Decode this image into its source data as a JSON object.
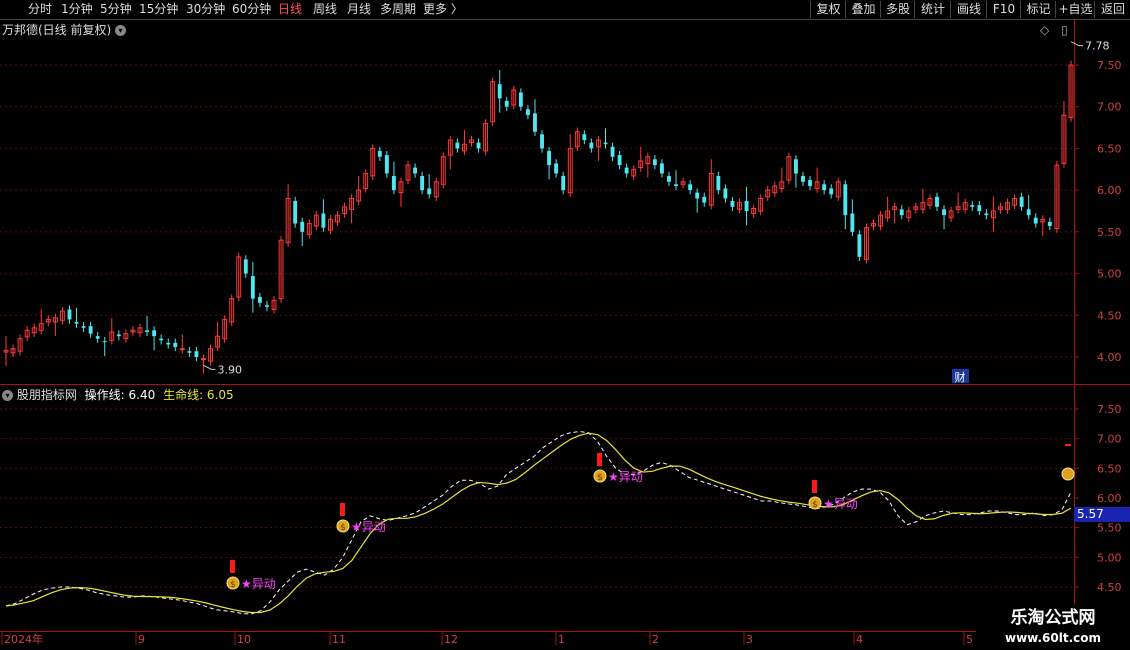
{
  "toolbar": {
    "left": [
      "分时",
      "1分钟",
      "5分钟",
      "15分钟",
      "30分钟",
      "60分钟",
      "日线",
      "周线",
      "月线",
      "多周期",
      "更多 〉"
    ],
    "active_index": 6,
    "right": [
      "复权",
      "叠加",
      "多股",
      "统计",
      "画线",
      "F10",
      "标记",
      "+自选",
      "返回"
    ]
  },
  "main_header": {
    "title": "万邦德(日线 前复权)"
  },
  "indicator_header": {
    "name": "股朋指标网",
    "op_label": "操作线: 6.40",
    "life_label": "生命线: 6.05"
  },
  "main_axis": [
    "7.50",
    "7.00",
    "6.50",
    "6.00",
    "5.50",
    "5.00",
    "4.50",
    "4.00"
  ],
  "sub_axis": [
    "7.50",
    "7.00",
    "6.50",
    "6.00",
    "5.50",
    "5.00",
    "4.50"
  ],
  "annotations": {
    "high": "7.78",
    "low": "3.90",
    "cai": "财"
  },
  "current_value": "5.57",
  "signal_label": "★异动",
  "x_labels": [
    "2024年",
    "9",
    "10",
    "11",
    "12",
    "1",
    "2",
    "3",
    "4",
    "5"
  ],
  "watermark": {
    "line1": "乐淘公式网",
    "line2": "www.60lt.com"
  },
  "colors": {
    "up": "#ff3a3a",
    "down": "#4ee6f0",
    "op_line": "#ffffff",
    "life_line": "#e6e63a",
    "signal": "#ff40ff"
  },
  "chart_data": {
    "type": "candlestick",
    "closes": [
      4.08,
      4.1,
      4.22,
      4.32,
      4.35,
      4.4,
      4.45,
      4.47,
      4.55,
      4.45,
      4.4,
      4.35,
      4.28,
      4.22,
      4.18,
      4.3,
      4.25,
      4.28,
      4.32,
      4.35,
      4.3,
      4.25,
      4.2,
      4.15,
      4.12,
      4.1,
      4.05,
      4.0,
      3.98,
      4.1,
      4.25,
      4.45,
      4.7,
      5.2,
      5.0,
      4.7,
      4.65,
      4.6,
      4.68,
      5.4,
      5.9,
      5.6,
      5.5,
      5.6,
      5.7,
      5.55,
      5.65,
      5.7,
      5.8,
      5.9,
      6.0,
      6.2,
      6.5,
      6.4,
      6.2,
      6.0,
      6.1,
      6.3,
      6.2,
      6.0,
      5.95,
      6.1,
      6.4,
      6.6,
      6.5,
      6.55,
      6.6,
      6.5,
      6.8,
      7.3,
      7.1,
      7.0,
      7.2,
      7.0,
      6.9,
      6.7,
      6.5,
      6.3,
      6.2,
      6.0,
      6.5,
      6.7,
      6.6,
      6.5,
      6.6,
      6.55,
      6.4,
      6.3,
      6.2,
      6.25,
      6.35,
      6.4,
      6.3,
      6.2,
      6.1,
      6.05,
      6.1,
      6.0,
      5.9,
      5.85,
      6.2,
      6.0,
      5.9,
      5.8,
      5.85,
      5.75,
      5.78,
      5.9,
      6.0,
      6.05,
      6.1,
      6.4,
      6.2,
      6.1,
      6.05,
      6.1,
      6.0,
      5.95,
      6.1,
      5.7,
      5.5,
      5.2,
      5.55,
      5.6,
      5.7,
      5.75,
      5.8,
      5.7,
      5.75,
      5.8,
      5.85,
      5.9,
      5.8,
      5.7,
      5.75,
      5.8,
      5.85,
      5.8,
      5.75,
      5.7,
      5.75,
      5.8,
      5.85,
      5.9,
      5.8,
      5.7,
      5.6,
      5.65,
      5.57,
      6.3,
      6.9,
      7.5
    ],
    "indicator": {
      "op_line": [
        4.18,
        4.22,
        4.3,
        4.38,
        4.45,
        4.48,
        4.5,
        4.5,
        4.48,
        4.45,
        4.4,
        4.37,
        4.35,
        4.33,
        4.33,
        4.35,
        4.34,
        4.32,
        4.3,
        4.28,
        4.25,
        4.22,
        4.17,
        4.12,
        4.1,
        4.08,
        4.05,
        4.05,
        4.1,
        4.25,
        4.45,
        4.6,
        4.75,
        4.8,
        4.75,
        4.7,
        4.8,
        5.0,
        5.3,
        5.6,
        5.7,
        5.65,
        5.62,
        5.66,
        5.7,
        5.75,
        5.85,
        5.95,
        6.05,
        6.2,
        6.3,
        6.3,
        6.25,
        6.15,
        6.2,
        6.4,
        6.5,
        6.6,
        6.7,
        6.85,
        6.95,
        7.05,
        7.1,
        7.12,
        7.1,
        6.95,
        6.7,
        6.5,
        6.4,
        6.4,
        6.45,
        6.55,
        6.6,
        6.55,
        6.45,
        6.35,
        6.3,
        6.25,
        6.2,
        6.15,
        6.1,
        6.05,
        6.0,
        5.95,
        5.95,
        5.92,
        5.9,
        5.88,
        5.85,
        5.82,
        5.85,
        5.9,
        6.0,
        6.1,
        6.15,
        6.15,
        6.1,
        5.95,
        5.7,
        5.55,
        5.6,
        5.7,
        5.75,
        5.78,
        5.75,
        5.72,
        5.72,
        5.75,
        5.78,
        5.78,
        5.75,
        5.72,
        5.72,
        5.75,
        5.7,
        5.72,
        5.8,
        6.1
      ]
    }
  }
}
